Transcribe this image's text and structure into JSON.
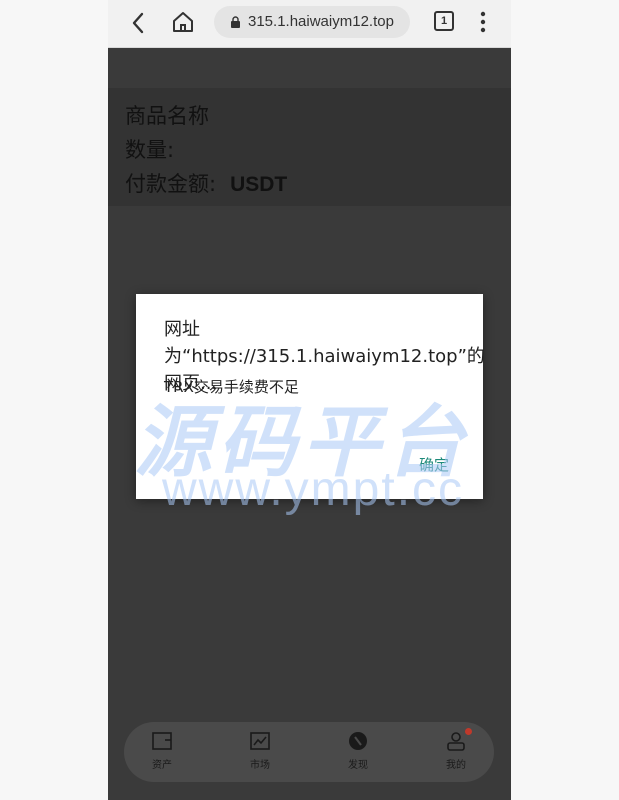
{
  "browser": {
    "url": "315.1.haiwaiym12.top",
    "tab_count": "1"
  },
  "order": {
    "product_label": "商品名称",
    "quantity_label": "数量:",
    "amount_label": "付款金额:",
    "currency": "USDT"
  },
  "dialog": {
    "title": "网址为“https://315.1.haiwaiym12.top”的网页...",
    "message": "TRX交易手续费不足",
    "ok_label": "确定"
  },
  "nav": {
    "items": [
      {
        "label": "资产",
        "icon": "wallet-icon"
      },
      {
        "label": "市场",
        "icon": "chart-icon"
      },
      {
        "label": "发现",
        "icon": "compass-icon"
      },
      {
        "label": "我的",
        "icon": "user-icon"
      }
    ]
  },
  "watermark": {
    "brand": "源码平台",
    "url": "www.ympt.cc"
  },
  "colors": {
    "accent": "#1e8a7a",
    "badge": "#c0392b",
    "watermark": "#aac8f5"
  }
}
